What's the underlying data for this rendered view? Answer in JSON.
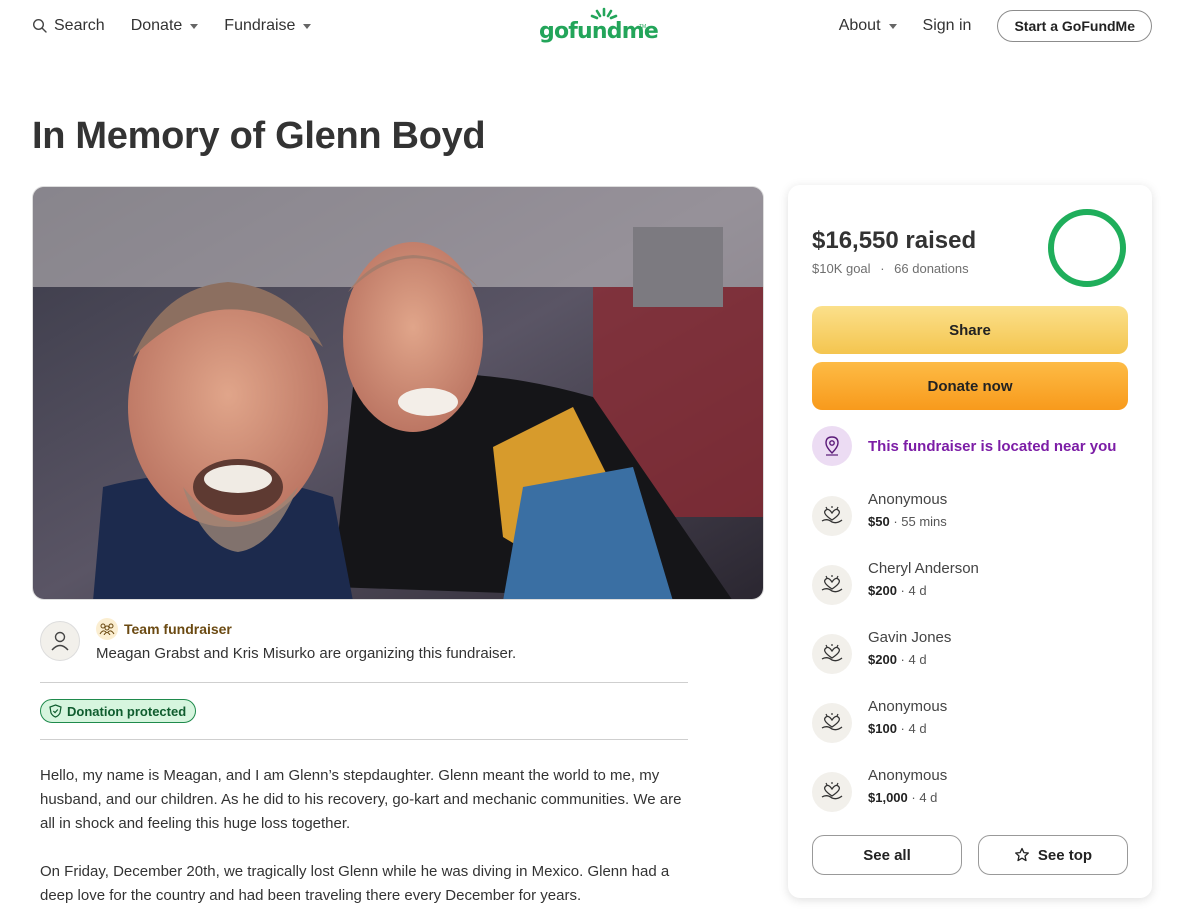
{
  "nav": {
    "search": "Search",
    "donate": "Donate",
    "fundraise": "Fundraise",
    "logo": "gofundme",
    "about": "About",
    "sign_in": "Sign in",
    "start": "Start a GoFundMe"
  },
  "page": {
    "title": "In Memory of Glenn Boyd"
  },
  "organizer": {
    "team_label": "Team fundraiser",
    "text": "Meagan Grabst and Kris Misurko are organizing this fundraiser.",
    "protected_label": "Donation protected"
  },
  "story": {
    "p1": "Hello, my name is Meagan, and I am Glenn’s stepdaughter. Glenn meant the world to me, my husband, and our children. As he did to his recovery, go-kart and mechanic communities. We are all in shock and feeling this huge loss together.",
    "p2": "On Friday, December 20th, we tragically lost Glenn while he was diving in Mexico. Glenn had a deep love for the country and had been traveling there every December for years."
  },
  "progress": {
    "raised": "$16,550 raised",
    "goal": "$10K goal",
    "separator": "·",
    "donations_count": "66 donations",
    "fraction": 1.0,
    "ring_color": "#1fae5b"
  },
  "actions": {
    "share": "Share",
    "donate_now": "Donate now",
    "nearby": "This fundraiser is located near you",
    "see_all": "See all",
    "see_top": "See top"
  },
  "donations": [
    {
      "name": "Anonymous",
      "amount": "$50",
      "time": "55 mins"
    },
    {
      "name": "Cheryl Anderson",
      "amount": "$200",
      "time": "4 d"
    },
    {
      "name": "Gavin Jones",
      "amount": "$200",
      "time": "4 d"
    },
    {
      "name": "Anonymous",
      "amount": "$100",
      "time": "4 d"
    },
    {
      "name": "Anonymous",
      "amount": "$1,000",
      "time": "4 d"
    }
  ],
  "colors": {
    "brand": "#23a55a",
    "share_button": "#f6cd5e",
    "donate_button": "#f9a52c",
    "nearby_accent": "#7c1da6"
  }
}
